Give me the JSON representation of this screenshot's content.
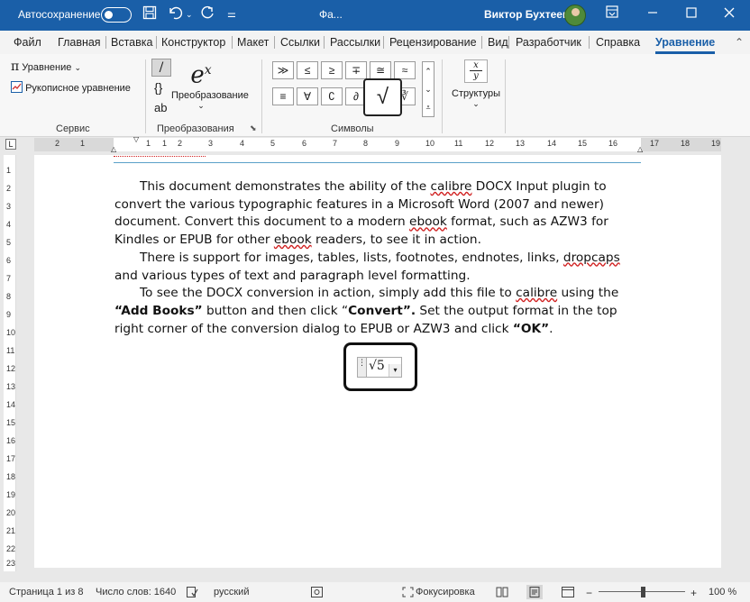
{
  "titlebar": {
    "autosave_label": "Автосохранение",
    "doc_title": "Фа...",
    "user_name": "Виктор Бухтеев",
    "icons": [
      "save-icon",
      "undo-icon",
      "redo-icon",
      "customize-icon",
      "ribbon-display-icon",
      "minimize-icon",
      "maximize-icon",
      "close-icon"
    ]
  },
  "menu": {
    "tabs": [
      "Файл",
      "Главная",
      "Вставка",
      "Конструктор",
      "Макет",
      "Ссылки",
      "Рассылки",
      "Рецензирование",
      "Вид",
      "Разработчик",
      "Справка",
      "Уравнение"
    ],
    "active": "Уравнение"
  },
  "ribbon": {
    "service": {
      "equation_label": "Уравнение",
      "ink_label": "Рукописное уравнение",
      "group_label": "Сервис"
    },
    "conversion": {
      "unicode_label": "/",
      "latex_label": "{}",
      "text_label": "ab",
      "convert_label": "Преобразование",
      "group_label": "Преобразования"
    },
    "symbols": {
      "row1": [
        "≫",
        "≤",
        "≥",
        "∓",
        "≅",
        "≈"
      ],
      "row2": [
        "≡",
        "∀",
        "∁",
        "∂",
        "√",
        "∛"
      ],
      "highlight": "√",
      "group_label": "Символы"
    },
    "structures": {
      "label": "Структуры",
      "fraction_top": "x",
      "fraction_bottom": "y"
    }
  },
  "ruler": {
    "numbers": [
      "2",
      "1",
      "1",
      "1",
      "2",
      "3",
      "4",
      "5",
      "6",
      "7",
      "8",
      "9",
      "10",
      "11",
      "12",
      "13",
      "14",
      "15",
      "16",
      "17",
      "18",
      "19"
    ]
  },
  "vruler": {
    "numbers": [
      "1",
      "2",
      "3",
      "4",
      "5",
      "6",
      "7",
      "8",
      "9",
      "10",
      "11",
      "12",
      "13",
      "14",
      "15",
      "16",
      "17",
      "18",
      "19",
      "20",
      "21",
      "22",
      "23"
    ]
  },
  "document": {
    "p1": {
      "a": "This document demonstrates the ability of the ",
      "calibre": "calibre",
      "b": " DOCX Input plugin to convert the various typographic features in a Microsoft Word (2007 and newer) document. Convert this document to a modern ",
      "ebook1": "ebook",
      "c": " format, such as AZW3 for Kindles or EPUB for other ",
      "ebook2": "ebook",
      "d": " readers, to see it in action."
    },
    "p2": {
      "a": "There is support for images, tables, lists, footnotes, endnotes, links, ",
      "dropcaps": "dropcaps",
      "b": " and various types of text and paragraph level formatting."
    },
    "p3": {
      "a": "To see the DOCX conversion in action, simply add this file to ",
      "calibre": "calibre",
      "b": " using the ",
      "add_books": "“Add Books”",
      "c": " button and then click “",
      "convert": "Convert”.",
      "d": "  Set the output format in the top right corner of the conversion dialog to EPUB or AZW3 and click ",
      "ok": "“OK”",
      "e": "."
    },
    "equation": "√5"
  },
  "status": {
    "page": "Страница 1 из 8",
    "words": "Число слов: 1640",
    "language": "русский",
    "focus": "Фокусировка",
    "zoom": "100 %",
    "zoom_minus": "−",
    "zoom_plus": "+"
  }
}
